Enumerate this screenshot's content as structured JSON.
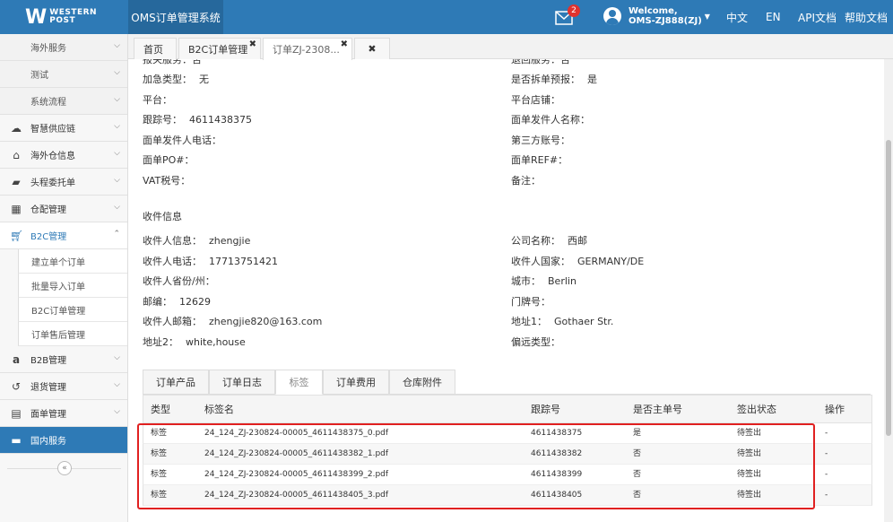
{
  "header": {
    "logo_text_line1": "WESTERN",
    "logo_text_line2": "POST",
    "system_name": "OMS订单管理系统",
    "mail_count": "2",
    "welcome": "Welcome,",
    "user_name": "OMS-ZJ888(ZJ)",
    "lang_zh": "中文",
    "lang_en": "EN",
    "api_docs": "API文档",
    "help_docs": "帮助文档"
  },
  "sidebar": {
    "items": [
      {
        "label": "海外服务",
        "icon": "none"
      },
      {
        "label": "测试",
        "icon": "none"
      },
      {
        "label": "系统流程",
        "icon": "none"
      },
      {
        "label": "智慧供应链",
        "icon": "cloud-icon"
      },
      {
        "label": "海外仓信息",
        "icon": "home-icon"
      },
      {
        "label": "头程委托单",
        "icon": "briefcase-icon"
      },
      {
        "label": "仓配管理",
        "icon": "grid-icon"
      },
      {
        "label": "B2C管理",
        "icon": "cart-icon"
      },
      {
        "label": "B2B管理",
        "icon": "amazon-icon"
      },
      {
        "label": "退货管理",
        "icon": "undo-icon"
      },
      {
        "label": "面单管理",
        "icon": "file-icon"
      },
      {
        "label": "国内服务",
        "icon": "folder-icon"
      }
    ],
    "b2c_children": [
      "建立单个订单",
      "批量导入订单",
      "B2C订单管理",
      "订单售后管理"
    ]
  },
  "tabs": [
    {
      "label": "首页"
    },
    {
      "label": "B2C订单管理"
    },
    {
      "label": "订单ZJ-2308..."
    }
  ],
  "fields": {
    "top_left_cut": "报关服务：否",
    "top_right_cut": "退回服务：否",
    "urgent_label": "加急类型：",
    "urgent_value": "无",
    "split_label": "是否拆单预报：",
    "split_value": "是",
    "platform_label": "平台：",
    "store_label": "平台店铺：",
    "tracking_label": "跟踪号：",
    "tracking_value": "4611438375",
    "sender_name_label": "面单发件人名称：",
    "sender_phone_label": "面单发件人电话：",
    "third_party_label": "第三方账号：",
    "po_label": "面单PO#：",
    "ref_label": "面单REF#：",
    "vat_label": "VAT税号：",
    "remark_label": "备注：",
    "receiver_section": "收件信息",
    "receiver_label": "收件人信息：",
    "receiver_value": "zhengjie",
    "company_label": "公司名称：",
    "company_value": "西邮",
    "receiver_phone_label": "收件人电话：",
    "receiver_phone_value": "17713751421",
    "country_label": "收件人国家：",
    "country_value": "GERMANY/DE",
    "province_label": "收件人省份/州：",
    "city_label": "城市：",
    "city_value": "Berlin",
    "zip_label": "邮编：",
    "zip_value": "12629",
    "door_label": "门牌号：",
    "email_label": "收件人邮箱：",
    "email_value": "zhengjie820@163.com",
    "address1_label": "地址1：",
    "address1_value": "Gothaer Str.",
    "address2_label": "地址2：",
    "address2_value": "white,house",
    "remote_label": "偏远类型："
  },
  "detail_tabs": [
    {
      "label": "订单产品"
    },
    {
      "label": "订单日志"
    },
    {
      "label": "标签"
    },
    {
      "label": "订单费用"
    },
    {
      "label": "仓库附件"
    }
  ],
  "table": {
    "headers": [
      "类型",
      "标签名",
      "跟踪号",
      "是否主单号",
      "签出状态",
      "操作"
    ],
    "rows": [
      [
        "标签",
        "24_124_ZJ-230824-00005_4611438375_0.pdf",
        "4611438375",
        "是",
        "待签出",
        "-"
      ],
      [
        "标签",
        "24_124_ZJ-230824-00005_4611438382_1.pdf",
        "4611438382",
        "否",
        "待签出",
        "-"
      ],
      [
        "标签",
        "24_124_ZJ-230824-00005_4611438399_2.pdf",
        "4611438399",
        "否",
        "待签出",
        "-"
      ],
      [
        "标签",
        "24_124_ZJ-230824-00005_4611438405_3.pdf",
        "4611438405",
        "否",
        "待签出",
        "-"
      ]
    ]
  }
}
